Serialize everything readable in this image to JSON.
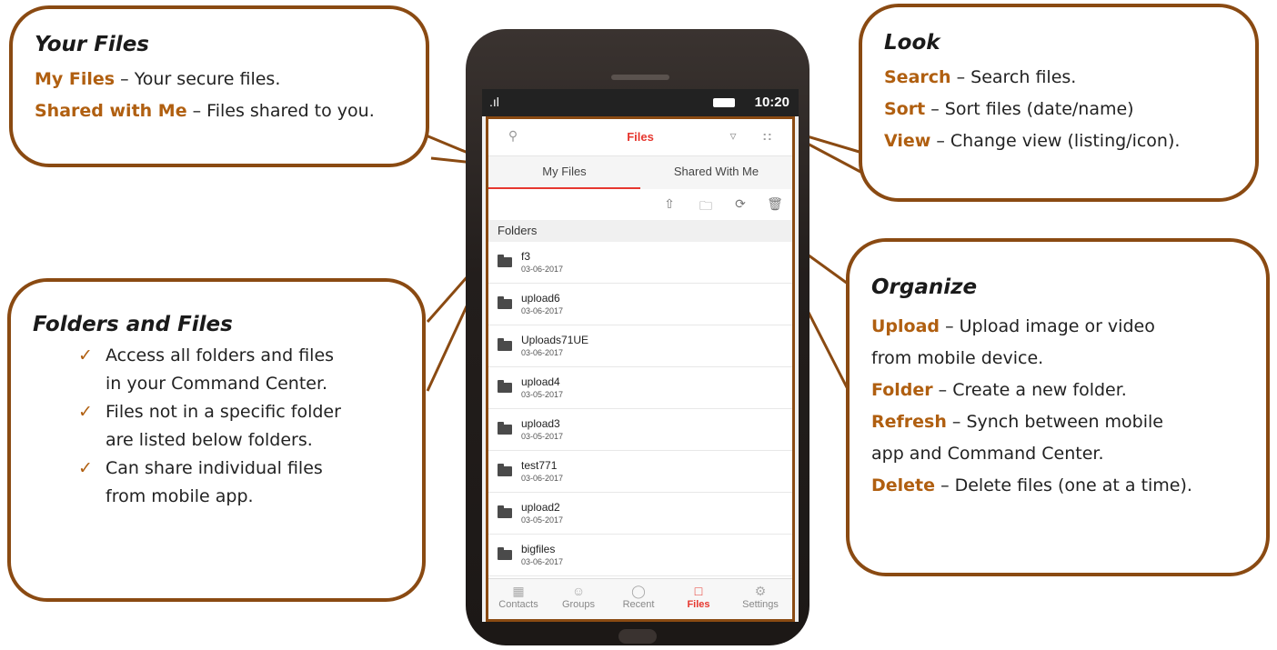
{
  "callouts": {
    "your_files": {
      "title": "Your Files",
      "lines": [
        {
          "keyword": "My Files",
          "text": " – Your secure files."
        },
        {
          "keyword": "Shared with Me",
          "text": " – Files shared to you."
        }
      ]
    },
    "look": {
      "title": "Look",
      "lines": [
        {
          "keyword": "Search",
          "text": " – Search files."
        },
        {
          "keyword": "Sort",
          "text": " – Sort files (date/name)"
        },
        {
          "keyword": "View",
          "text": " – Change view (listing/icon)."
        }
      ]
    },
    "folders_files": {
      "title": "Folders and Files",
      "items": [
        {
          "line1": "Access all folders and files",
          "line2": "in your Command Center."
        },
        {
          "line1": "Files not in a specific folder",
          "line2": "are listed below folders."
        },
        {
          "line1": "Can share individual files",
          "line2": "from mobile app."
        }
      ]
    },
    "organize": {
      "title": "Organize",
      "upload_keyword": "Upload",
      "upload_text": " – Upload image or video",
      "upload_text2": "from mobile device.",
      "folder_keyword": "Folder",
      "folder_text": " – Create a new folder.",
      "refresh_keyword": "Refresh",
      "refresh_text": " – Synch between mobile",
      "refresh_text2": "app and Command Center.",
      "delete_keyword": "Delete",
      "delete_text": " – Delete files (one at a time)."
    }
  },
  "phone": {
    "status": {
      "time": "10:20"
    },
    "app": {
      "title": "Files",
      "tabs": [
        "My Files",
        "Shared With Me"
      ],
      "active_tab": "My Files",
      "folders_header": "Folders",
      "folders": [
        {
          "name": "f3",
          "date": "03-06-2017"
        },
        {
          "name": "upload6",
          "date": "03-06-2017"
        },
        {
          "name": "Uploads71UE",
          "date": "03-06-2017"
        },
        {
          "name": "upload4",
          "date": "03-05-2017"
        },
        {
          "name": "upload3",
          "date": "03-05-2017"
        },
        {
          "name": "test771",
          "date": "03-06-2017"
        },
        {
          "name": "upload2",
          "date": "03-05-2017"
        },
        {
          "name": "bigfiles",
          "date": "03-06-2017"
        }
      ],
      "bottom_nav": [
        "Contacts",
        "Groups",
        "Recent",
        "Files",
        "Settings"
      ],
      "active_nav": "Files"
    }
  },
  "colors": {
    "accent_brown": "#8a4a12",
    "keyword_orange": "#b05f10",
    "app_red": "#e6372f"
  },
  "icons": [
    "search-icon",
    "filter-icon",
    "view-grid-icon",
    "upload-icon",
    "new-folder-icon",
    "refresh-icon",
    "trash-icon",
    "folder-icon",
    "contacts-icon",
    "groups-icon",
    "recent-icon",
    "files-icon",
    "settings-icon",
    "checkmark-icon",
    "signal-icon",
    "battery-icon"
  ]
}
